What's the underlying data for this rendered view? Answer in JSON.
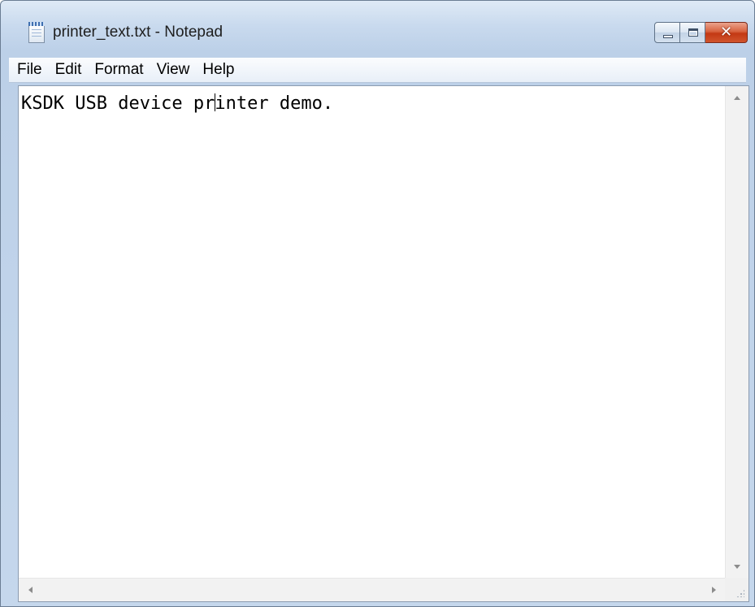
{
  "window": {
    "title": "printer_text.txt - Notepad",
    "icon": "notepad-icon",
    "controls": {
      "minimize": "minimize-icon",
      "maximize": "maximize-icon",
      "close_glyph": "✕"
    },
    "close_color": "#c8401c"
  },
  "menu": {
    "items": [
      {
        "label": "File"
      },
      {
        "label": "Edit"
      },
      {
        "label": "Format"
      },
      {
        "label": "View"
      },
      {
        "label": "Help"
      }
    ]
  },
  "editor": {
    "text_before_caret": "KSDK USB device pr",
    "text_after_caret": "inter demo."
  }
}
